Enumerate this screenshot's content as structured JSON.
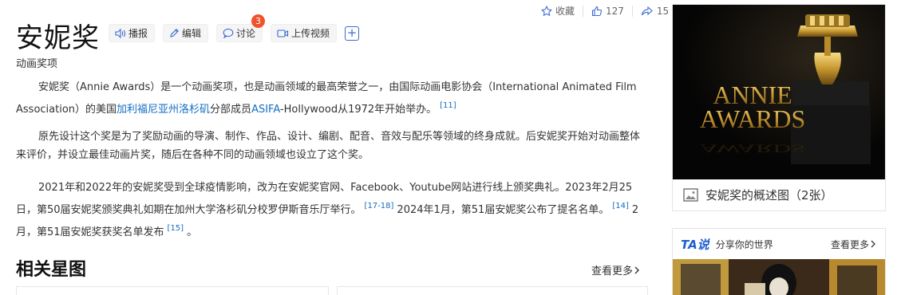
{
  "stats": {
    "favorite_label": "收藏",
    "like_count": "127",
    "share_count": "15"
  },
  "title": "安妮奖",
  "actions": {
    "broadcast": "播报",
    "edit": "编辑",
    "discuss": "讨论",
    "discuss_badge": "3",
    "upload_video": "上传视频",
    "add": "+"
  },
  "subtitle": "动画奖项",
  "paragraphs": {
    "p1": {
      "t1": "安妮奖（Annie Awards）是一个动画奖项，也是动画领域的最高荣誉之一，由国际动画电影协会（International Animated Film Association）的美国",
      "link1": "加利福尼亚州洛杉矶",
      "t2": "分部成员",
      "link2": "ASIFA",
      "t3": "-Hollywood从1972年开始举办。",
      "ref1": "[11]"
    },
    "p2": {
      "t1": "原先设计这个奖是为了奖励动画的导演、制作、作品、设计、编剧、配音、音效与配乐等领域的终身成就。后安妮奖开始对动画整体来评价，并设立最佳动画片奖，随后在各种不同的动画领域也设立了这个奖。"
    },
    "p3": {
      "t1": "2021年和2022年的安妮奖受到全球疫情影响，改为在安妮奖官网、Facebook、Youtube网站进行线上颁奖典礼。2023年2月25日，第50届安妮奖颁奖典礼如期在加州大学洛杉矶分校罗伊斯音乐厅举行。",
      "ref1": "[17-18]",
      "t2": "2024年1月，第51届安妮奖公布了提名名单。",
      "ref2": "[14]",
      "t3": "2月，第51届安妮奖获奖名单发布",
      "ref3": "[15]",
      "t4": "。"
    }
  },
  "section": {
    "title": "相关星图",
    "more": "查看更多"
  },
  "album": {
    "image_text_line1": "ANNIE",
    "image_text_line2": "AWARDS",
    "caption": "安妮奖的概述图（2张）"
  },
  "ta": {
    "logo": "TA说",
    "tagline": "分享你的世界",
    "more": "查看更多"
  }
}
